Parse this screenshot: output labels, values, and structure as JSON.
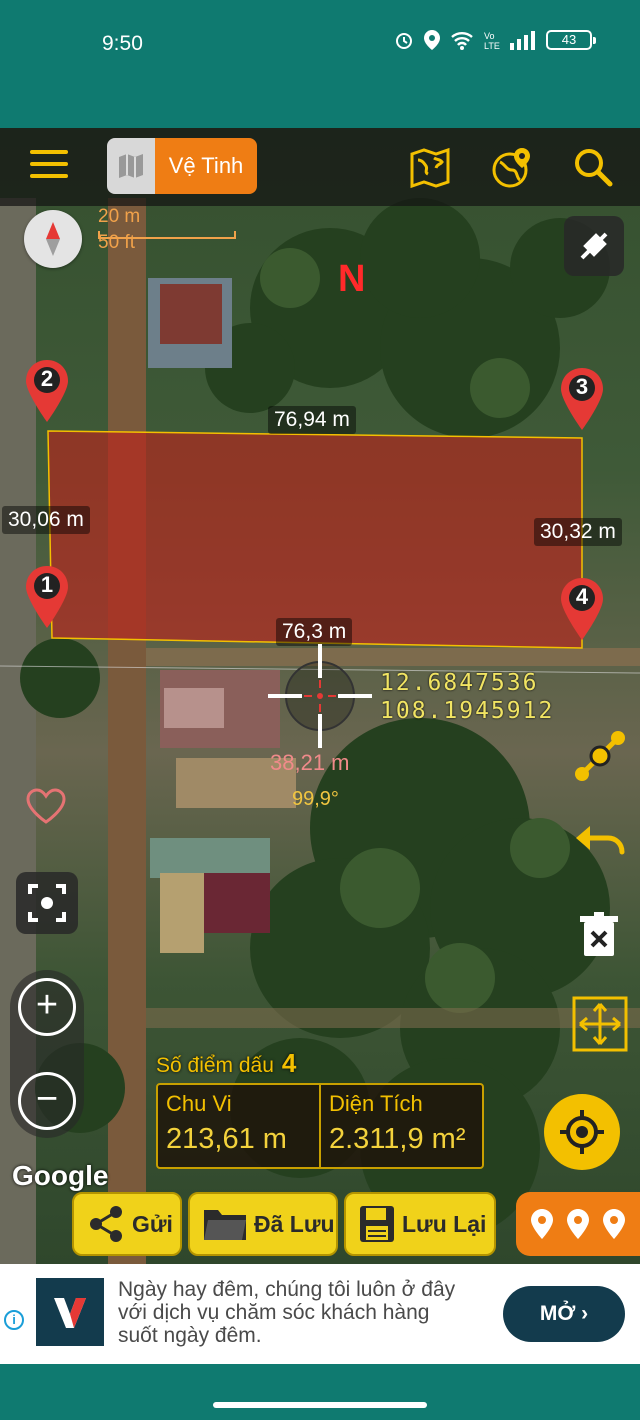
{
  "status_bar": {
    "time": "9:50",
    "battery": "43"
  },
  "toolbar": {
    "map_type_label": "Vệ Tinh"
  },
  "scale": {
    "metric": "20 m",
    "imperial": "50 ft"
  },
  "north_label": "N",
  "measurements": {
    "top_edge": "76,94 m",
    "left_edge": "30,06 m",
    "right_edge": "30,32 m",
    "bottom_edge": "76,3 m"
  },
  "markers": [
    "1",
    "2",
    "3",
    "4"
  ],
  "crosshair": {
    "latitude": "12.6847536",
    "longitude": "108.1945912",
    "distance": "38,21 m",
    "bearing": "99,9°"
  },
  "stats": {
    "points_label": "Số điểm dấu",
    "points_count": "4",
    "perimeter_label": "Chu Vi",
    "perimeter_value": "213,61 m",
    "area_label": "Diện Tích",
    "area_value": "2.311,9 m²"
  },
  "attribution": "Google",
  "bottom_buttons": {
    "send": "Gửi",
    "saved": "Đã Lưu",
    "save": "Lưu Lại"
  },
  "ad": {
    "text": "Ngày hay đêm, chúng tôi luôn ở đây với dịch vụ chăm sóc khách hàng suốt ngày đêm.",
    "button": "MỞ ›"
  },
  "colors": {
    "accent": "#f3c000",
    "brand_bar": "#0f7a70",
    "polygon": "#c0221c",
    "map_type": "#ef7d14"
  }
}
